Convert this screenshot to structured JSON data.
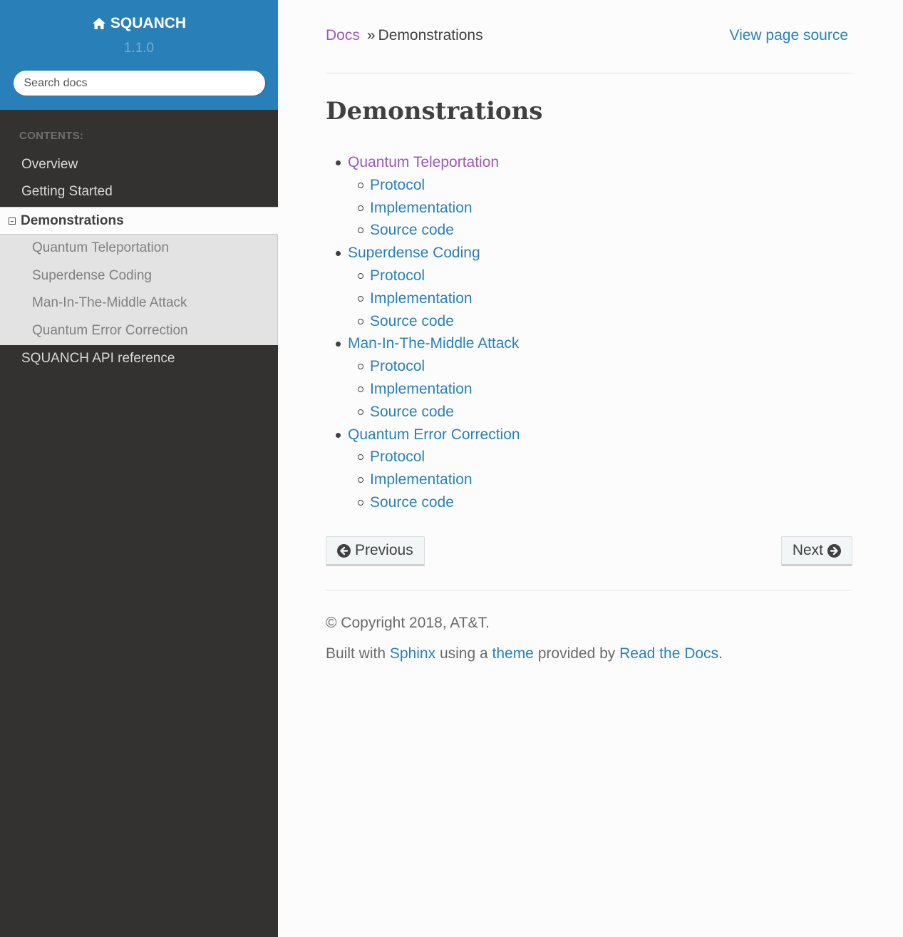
{
  "sidebar": {
    "project_name": "SQUANCH",
    "version": "1.1.0",
    "search_placeholder": "Search docs",
    "caption": "CONTENTS:",
    "items": [
      "Overview",
      "Getting Started"
    ],
    "current": "Demonstrations",
    "subitems": [
      "Quantum Teleportation",
      "Superdense Coding",
      "Man-In-The-Middle Attack",
      "Quantum Error Correction"
    ],
    "last_item": "SQUANCH API reference",
    "colors": {
      "header": "#2980b9",
      "background": "#343131"
    }
  },
  "breadcrumb": {
    "docs": "Docs",
    "separator": "»",
    "current": "Demonstrations"
  },
  "view_source": "View page source",
  "title": "Demonstrations",
  "toc": [
    {
      "label": "Quantum Teleportation",
      "children": [
        "Protocol",
        "Implementation",
        "Source code"
      ]
    },
    {
      "label": "Superdense Coding",
      "children": [
        "Protocol",
        "Implementation",
        "Source code"
      ]
    },
    {
      "label": "Man-In-The-Middle Attack",
      "children": [
        "Protocol",
        "Implementation",
        "Source code"
      ]
    },
    {
      "label": "Quantum Error Correction",
      "children": [
        "Protocol",
        "Implementation",
        "Source code"
      ]
    }
  ],
  "nav": {
    "previous": "Previous",
    "next": "Next"
  },
  "footer": {
    "copyright": "© Copyright 2018, AT&T.",
    "built_with": "Built with",
    "sphinx": "Sphinx",
    "using_a": "using a",
    "theme": "theme",
    "provided_by": "provided by",
    "rtd": "Read the Docs",
    "period": "."
  },
  "colors": {
    "link": "#2980b9",
    "visited": "#9b59b6",
    "text": "#404040"
  }
}
